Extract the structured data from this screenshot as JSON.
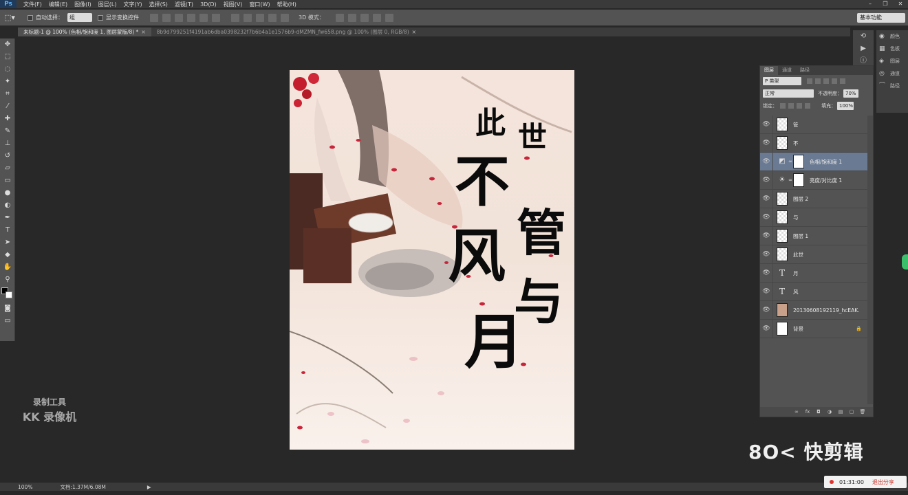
{
  "app": {
    "name": "Ps"
  },
  "menu": [
    "文件(F)",
    "编辑(E)",
    "图像(I)",
    "图层(L)",
    "文字(Y)",
    "选择(S)",
    "滤镜(T)",
    "3D(D)",
    "视图(V)",
    "窗口(W)",
    "帮助(H)"
  ],
  "options": {
    "auto_select_label": "自动选择：",
    "auto_select_value": "组",
    "transform_label": "显示变换控件",
    "mode3d_label": "3D 模式：",
    "workspace": "基本功能"
  },
  "tabs": [
    {
      "label": "未标题-1 @ 100% (色相/饱和度 1, 图层蒙版/8) *",
      "active": true
    },
    {
      "label": "8b9d799251f4191ab6dba0398232f7b6b4a1e1576b9-dMZMN_fw658.png @ 100% (图层 0, RGB/8)",
      "active": false
    }
  ],
  "poster": {
    "lines": [
      "此",
      "世",
      "不",
      "管",
      "风",
      "与",
      "月"
    ]
  },
  "watermark": {
    "line1": "录制工具",
    "line2": "KK 录像机"
  },
  "brand": "快剪辑",
  "right_strip": [
    {
      "icon": "history-icon",
      "label": "颜色"
    },
    {
      "icon": "swatches-icon",
      "label": "色板"
    },
    {
      "icon": "layers-icon",
      "label": "图层"
    },
    {
      "icon": "channels-icon",
      "label": "通道"
    },
    {
      "icon": "paths-icon",
      "label": "路径"
    }
  ],
  "layers_panel": {
    "tabs": [
      "图层",
      "通道",
      "路径"
    ],
    "kind_filter": "P 类型",
    "blend_mode": "正常",
    "opacity_label": "不透明度：",
    "opacity": "70%",
    "lock_label": "锁定：",
    "fill_label": "填充：",
    "fill": "100%",
    "layers": [
      {
        "name": "管",
        "thumb": "checker",
        "selected": false
      },
      {
        "name": "不",
        "thumb": "checker",
        "selected": false
      },
      {
        "name": "色相/饱和度 1",
        "thumb": "adjust-hue",
        "selected": true
      },
      {
        "name": "亮度/对比度 1",
        "thumb": "adjust-sun",
        "selected": false
      },
      {
        "name": "图层 2",
        "thumb": "checker",
        "selected": false
      },
      {
        "name": "与",
        "thumb": "checker",
        "selected": false
      },
      {
        "name": "图层 1",
        "thumb": "checker",
        "selected": false
      },
      {
        "name": "此世",
        "thumb": "checker",
        "selected": false
      },
      {
        "name": "月",
        "thumb": "text",
        "selected": false
      },
      {
        "name": "风",
        "thumb": "text",
        "selected": false
      },
      {
        "name": "20130608192119_hcEAK.t...",
        "thumb": "photo",
        "selected": false
      },
      {
        "name": "背景",
        "thumb": "white",
        "selected": false,
        "locked": true
      }
    ]
  },
  "status": {
    "zoom": "100%",
    "doc": "文档:1.37M/6.08M"
  },
  "recorder": {
    "time": "01:31:00",
    "exit": "退出分享"
  }
}
